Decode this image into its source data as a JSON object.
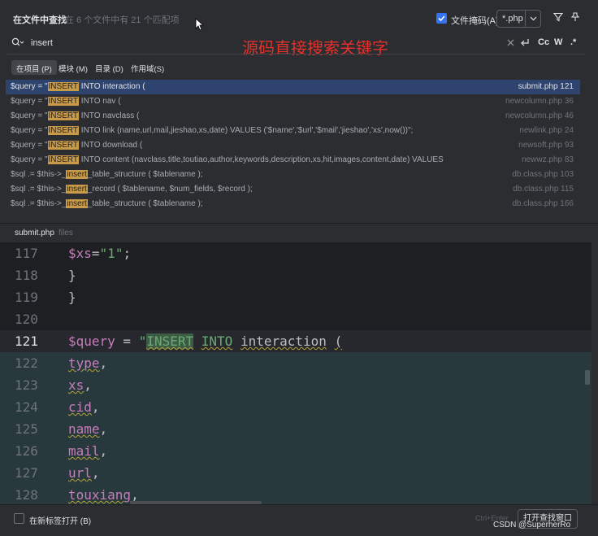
{
  "header": {
    "title": "在文件中查找",
    "summary": "在 6 个文件中有 21 个匹配项",
    "file_mask_label": "文件掩码(A):",
    "file_mask_value": "*.php",
    "file_mask_checked": true
  },
  "search": {
    "query": "insert",
    "annotation": "源码直接搜索关键字",
    "tools": [
      "Cc",
      "W",
      ".*"
    ]
  },
  "scope_tabs": [
    {
      "label": "在项目 (P)",
      "active": true
    },
    {
      "label": "模块 (M)",
      "active": false
    },
    {
      "label": "目录 (D)",
      "active": false
    },
    {
      "label": "作用域(S)",
      "active": false
    }
  ],
  "results": [
    {
      "pre": "$query = \"",
      "match": "INSERT",
      "post": " INTO interaction (",
      "file": "submit.php 121",
      "selected": true
    },
    {
      "pre": "$query = \"",
      "match": "INSERT",
      "post": " INTO nav (",
      "file": "newcolumn.php 36",
      "selected": false
    },
    {
      "pre": "$query = \"",
      "match": "INSERT",
      "post": " INTO navclass (",
      "file": "newcolumn.php 46",
      "selected": false
    },
    {
      "pre": "$query = \"",
      "match": "INSERT",
      "post": " INTO link (name,url,mail,jieshao,xs,date) VALUES ('$name','$url','$mail','jieshao','xs',now())\";",
      "file": "newlink.php 24",
      "selected": false
    },
    {
      "pre": "$query = \"",
      "match": "INSERT",
      "post": " INTO download (",
      "file": "newsoft.php 93",
      "selected": false
    },
    {
      "pre": "$query = \"",
      "match": "INSERT",
      "post": " INTO content (navclass,title,toutiao,author,keywords,description,xs,hit,images,content,date) VALUES",
      "file": "newwz.php 83",
      "selected": false
    },
    {
      "pre": "$sql .= $this->_",
      "match": "insert",
      "post": "_table_structure ( $tablename );",
      "file": "db.class.php 103",
      "selected": false
    },
    {
      "pre": "$sql .= $this->_",
      "match": "insert",
      "post": "_record ( $tablename, $num_fields, $record );",
      "file": "db.class.php 115",
      "selected": false
    },
    {
      "pre": "$sql .= $this->_",
      "match": "insert",
      "post": "_table_structure ( $tablename );",
      "file": "db.class.php 166",
      "selected": false
    }
  ],
  "preview": {
    "file_name": "submit.php",
    "path": "files"
  },
  "editor_lines": [
    {
      "num": "117",
      "text": "$xs=\"1\";"
    },
    {
      "num": "118",
      "text": "}"
    },
    {
      "num": "119",
      "text": "}"
    },
    {
      "num": "120",
      "text": ""
    },
    {
      "num": "121",
      "text": "$query = \"INSERT INTO interaction ("
    },
    {
      "num": "122",
      "text": "type,"
    },
    {
      "num": "123",
      "text": "xs,"
    },
    {
      "num": "124",
      "text": "cid,"
    },
    {
      "num": "125",
      "text": "name,"
    },
    {
      "num": "126",
      "text": "mail,"
    },
    {
      "num": "127",
      "text": "url,"
    },
    {
      "num": "128",
      "text": "touxiang,"
    }
  ],
  "footer": {
    "new_tab_label": "在新标签打开 (B)",
    "shortcut_hint": "Ctrl+Enter",
    "open_window_label": "打开查找窗口"
  },
  "watermark": "CSDN @SuperherRo",
  "colors": {
    "accent": "#3574f0",
    "match_highlight": "#c99b49",
    "annotation": "#e8302a"
  }
}
